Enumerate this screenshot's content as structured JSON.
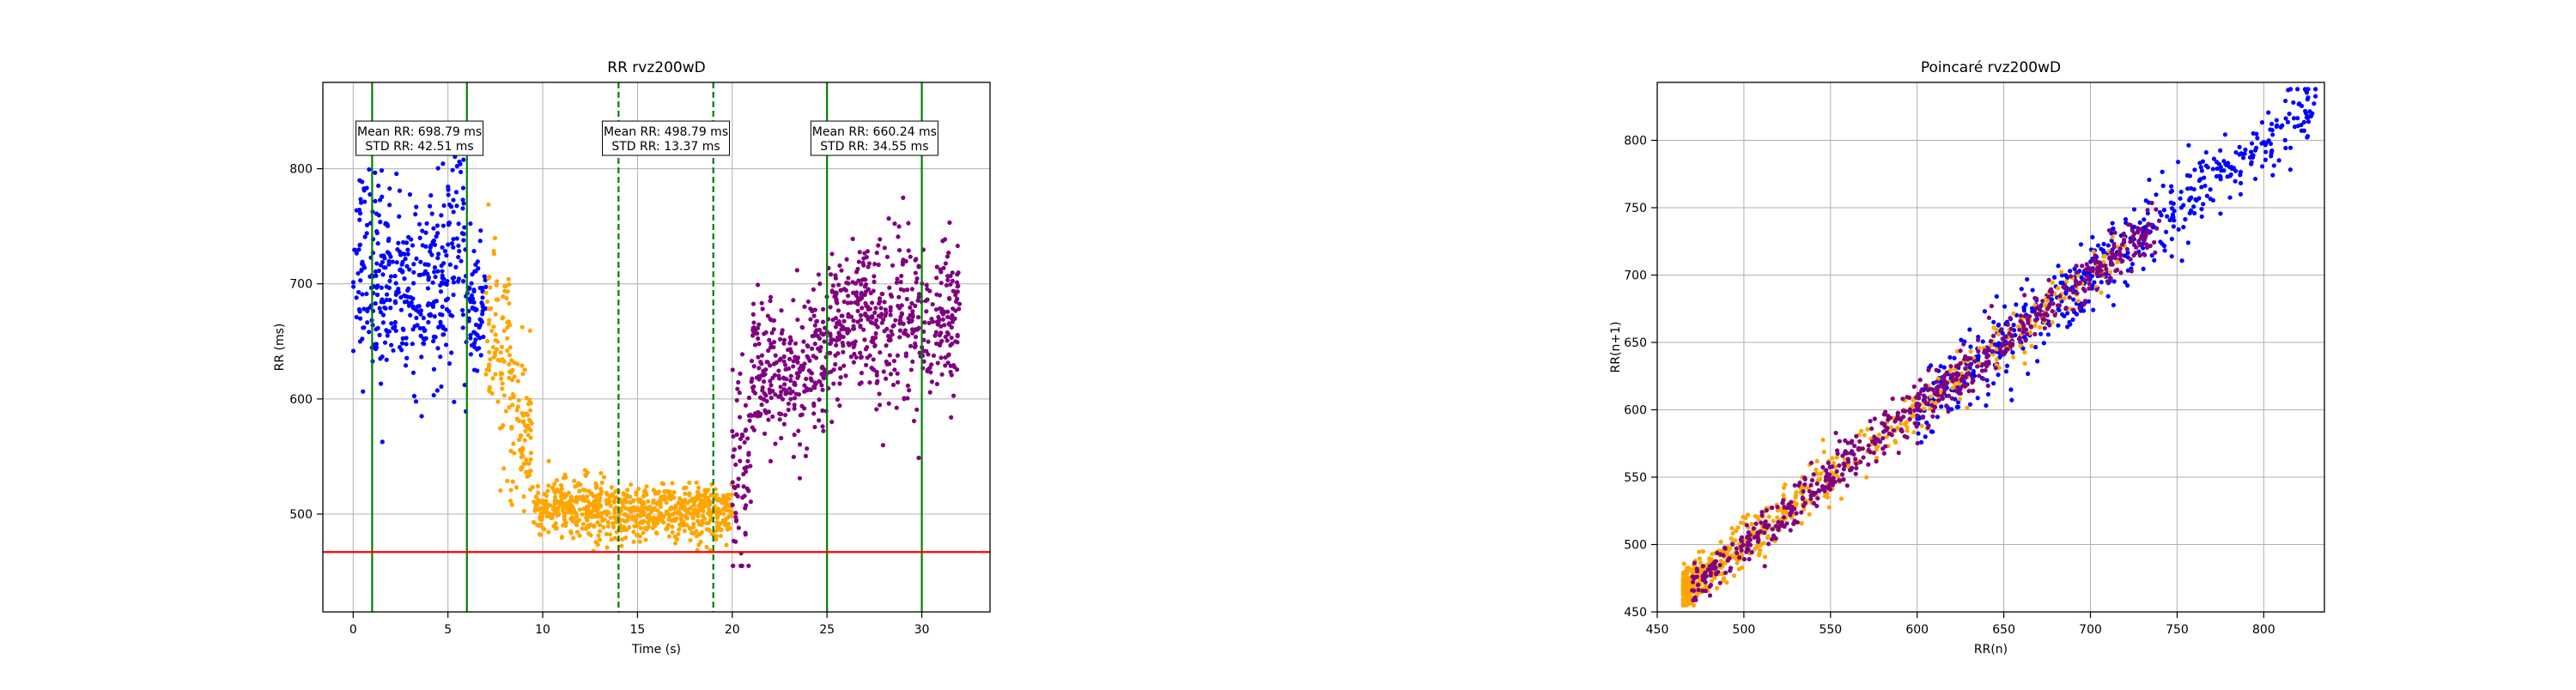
{
  "colors": {
    "baseline": "#0000ff",
    "exercise": "#ffa500",
    "recovery": "#800080",
    "marker_line": "#008000",
    "threshold_line": "#ff0000",
    "grid": "#b0b0b0"
  },
  "chart_data": [
    {
      "type": "scatter",
      "title": "RR rvz200wD",
      "xlabel": "Time (s)",
      "ylabel": "RR (ms)",
      "xlim": [
        -1.6,
        33.6
      ],
      "ylim": [
        415,
        875
      ],
      "xticks": [
        0,
        5,
        10,
        15,
        20,
        25,
        30
      ],
      "yticks": [
        500,
        600,
        700,
        800
      ],
      "grid": true,
      "vertical_lines": [
        {
          "x": 1,
          "style": "solid"
        },
        {
          "x": 6,
          "style": "solid"
        },
        {
          "x": 14,
          "style": "dashed"
        },
        {
          "x": 19,
          "style": "dashed"
        },
        {
          "x": 25,
          "style": "solid"
        },
        {
          "x": 30,
          "style": "solid"
        }
      ],
      "horizontal_line": {
        "y": 467
      },
      "annotations": [
        {
          "x": 3.5,
          "y": 825,
          "lines": [
            "Mean RR: 698.79 ms",
            "STD RR: 42.51 ms"
          ]
        },
        {
          "x": 16.5,
          "y": 825,
          "lines": [
            "Mean RR: 498.79 ms",
            "STD RR: 13.37 ms"
          ]
        },
        {
          "x": 27.5,
          "y": 825,
          "lines": [
            "Mean RR: 660.24 ms",
            "STD RR: 34.55 ms"
          ]
        }
      ],
      "series": [
        {
          "color_key": "baseline",
          "segments": [
            {
              "x0": 0.0,
              "x1": 1.5,
              "mean": 715,
              "sd": 45
            },
            {
              "x0": 1.5,
              "x1": 5.0,
              "mean": 695,
              "sd": 38
            },
            {
              "x0": 5.0,
              "x1": 6.0,
              "mean": 730,
              "sd": 55
            },
            {
              "x0": 6.0,
              "x1": 7.0,
              "mean": 680,
              "sd": 30
            }
          ]
        },
        {
          "color_key": "exercise",
          "segments": [
            {
              "x0": 7.0,
              "x1": 8.3,
              "mean": 640,
              "sd": 42
            },
            {
              "x0": 8.3,
              "x1": 9.5,
              "mean": 575,
              "sd": 35
            },
            {
              "x0": 9.5,
              "x1": 14.0,
              "mean": 505,
              "sd": 13
            },
            {
              "x0": 14.0,
              "x1": 20.0,
              "mean": 500,
              "sd": 12
            }
          ]
        },
        {
          "color_key": "recovery",
          "segments": [
            {
              "x0": 20.0,
              "x1": 21.0,
              "mean": 545,
              "sd": 45
            },
            {
              "x0": 21.0,
              "x1": 25.0,
              "mean": 625,
              "sd": 32
            },
            {
              "x0": 25.0,
              "x1": 32.0,
              "mean": 665,
              "sd": 35
            }
          ]
        }
      ]
    },
    {
      "type": "scatter",
      "title": "Poincaré rvz200wD",
      "xlabel": "RR(n)",
      "ylabel": "RR(n+1)",
      "xlim": [
        450,
        835
      ],
      "ylim": [
        450,
        843
      ],
      "xticks": [
        450,
        500,
        550,
        600,
        650,
        700,
        750,
        800
      ],
      "yticks": [
        450,
        500,
        550,
        600,
        650,
        700,
        750,
        800
      ],
      "grid": true,
      "series": [
        {
          "color_key": "baseline",
          "range": [
            600,
            830
          ],
          "spread": 14
        },
        {
          "color_key": "exercise",
          "range": [
            465,
            720
          ],
          "spread": 9
        },
        {
          "color_key": "recovery",
          "range": [
            470,
            740
          ],
          "spread": 9
        }
      ]
    }
  ]
}
